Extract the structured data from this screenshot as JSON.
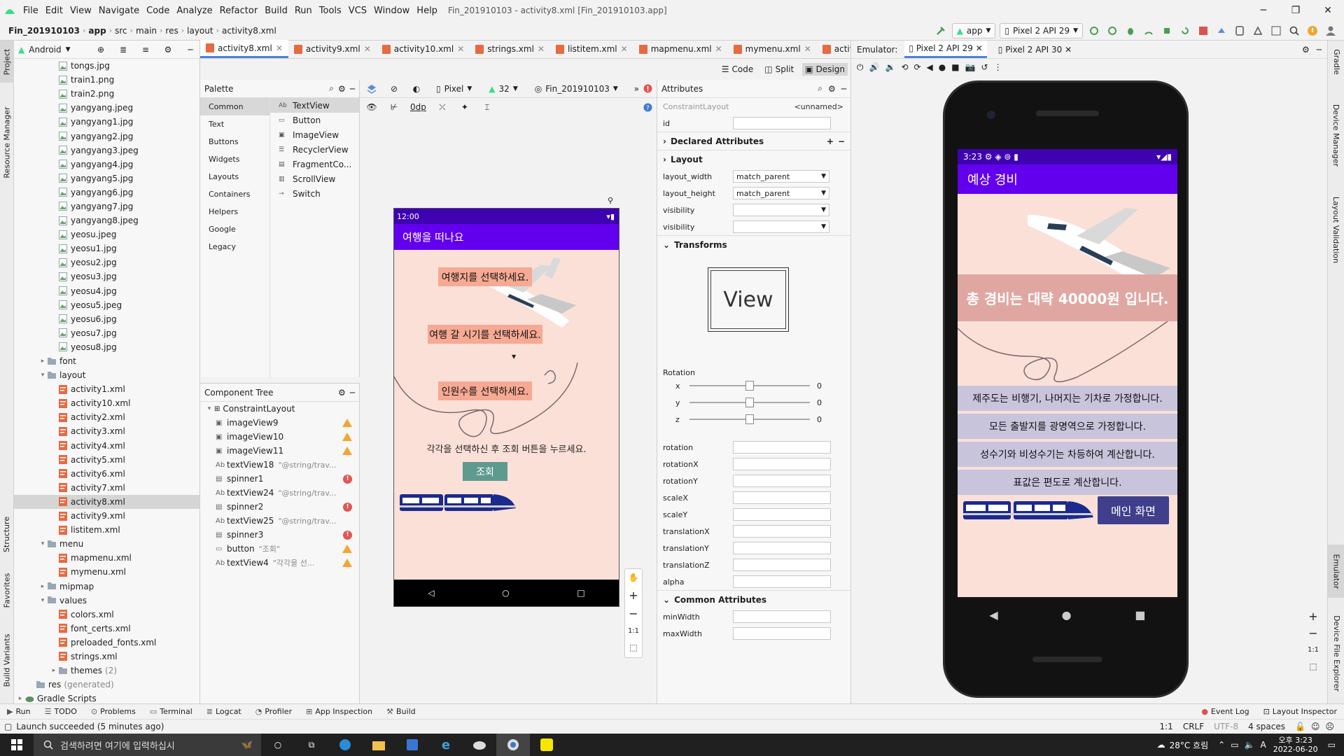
{
  "window": {
    "menu": [
      "File",
      "Edit",
      "View",
      "Navigate",
      "Code",
      "Analyze",
      "Refactor",
      "Build",
      "Run",
      "Tools",
      "VCS",
      "Window",
      "Help"
    ],
    "title": "Fin_201910103 - activity8.xml [Fin_201910103.app]"
  },
  "breadcrumb": [
    "Fin_201910103",
    "app",
    "src",
    "main",
    "res",
    "layout",
    "activity8.xml"
  ],
  "run_config": {
    "module": "app",
    "device": "Pixel 2 API 29"
  },
  "project": {
    "view": "Android",
    "tree": [
      {
        "name": "tongs.jpg",
        "depth": 3,
        "type": "img"
      },
      {
        "name": "train1.png",
        "depth": 3,
        "type": "img"
      },
      {
        "name": "train2.png",
        "depth": 3,
        "type": "img"
      },
      {
        "name": "yangyang.jpeg",
        "depth": 3,
        "type": "img"
      },
      {
        "name": "yangyang1.jpg",
        "depth": 3,
        "type": "img"
      },
      {
        "name": "yangyang2.jpg",
        "depth": 3,
        "type": "img"
      },
      {
        "name": "yangyang3.jpeg",
        "depth": 3,
        "type": "img"
      },
      {
        "name": "yangyang4.jpg",
        "depth": 3,
        "type": "img"
      },
      {
        "name": "yangyang5.jpg",
        "depth": 3,
        "type": "img"
      },
      {
        "name": "yangyang6.jpg",
        "depth": 3,
        "type": "img"
      },
      {
        "name": "yangyang7.jpg",
        "depth": 3,
        "type": "img"
      },
      {
        "name": "yangyang8.jpeg",
        "depth": 3,
        "type": "img"
      },
      {
        "name": "yeosu.jpeg",
        "depth": 3,
        "type": "img"
      },
      {
        "name": "yeosu1.jpg",
        "depth": 3,
        "type": "img"
      },
      {
        "name": "yeosu2.jpg",
        "depth": 3,
        "type": "img"
      },
      {
        "name": "yeosu3.jpg",
        "depth": 3,
        "type": "img"
      },
      {
        "name": "yeosu4.jpg",
        "depth": 3,
        "type": "img"
      },
      {
        "name": "yeosu5.jpeg",
        "depth": 3,
        "type": "img"
      },
      {
        "name": "yeosu6.jpg",
        "depth": 3,
        "type": "img"
      },
      {
        "name": "yeosu7.jpg",
        "depth": 3,
        "type": "img"
      },
      {
        "name": "yeosu8.jpg",
        "depth": 3,
        "type": "img"
      },
      {
        "name": "font",
        "depth": 2,
        "type": "folder",
        "arrow": "▸"
      },
      {
        "name": "layout",
        "depth": 2,
        "type": "folder",
        "arrow": "▾"
      },
      {
        "name": "activity1.xml",
        "depth": 3,
        "type": "xml"
      },
      {
        "name": "activity10.xml",
        "depth": 3,
        "type": "xml"
      },
      {
        "name": "activity2.xml",
        "depth": 3,
        "type": "xml"
      },
      {
        "name": "activity3.xml",
        "depth": 3,
        "type": "xml"
      },
      {
        "name": "activity4.xml",
        "depth": 3,
        "type": "xml"
      },
      {
        "name": "activity5.xml",
        "depth": 3,
        "type": "xml"
      },
      {
        "name": "activity6.xml",
        "depth": 3,
        "type": "xml"
      },
      {
        "name": "activity7.xml",
        "depth": 3,
        "type": "xml"
      },
      {
        "name": "activity8.xml",
        "depth": 3,
        "type": "xml",
        "selected": true
      },
      {
        "name": "activity9.xml",
        "depth": 3,
        "type": "xml"
      },
      {
        "name": "listitem.xml",
        "depth": 3,
        "type": "xml"
      },
      {
        "name": "menu",
        "depth": 2,
        "type": "folder",
        "arrow": "▾"
      },
      {
        "name": "mapmenu.xml",
        "depth": 3,
        "type": "xml"
      },
      {
        "name": "mymenu.xml",
        "depth": 3,
        "type": "xml"
      },
      {
        "name": "mipmap",
        "depth": 2,
        "type": "folder",
        "arrow": "▸"
      },
      {
        "name": "values",
        "depth": 2,
        "type": "folder",
        "arrow": "▾"
      },
      {
        "name": "colors.xml",
        "depth": 3,
        "type": "xml"
      },
      {
        "name": "font_certs.xml",
        "depth": 3,
        "type": "xml"
      },
      {
        "name": "preloaded_fonts.xml",
        "depth": 3,
        "type": "xml"
      },
      {
        "name": "strings.xml",
        "depth": 3,
        "type": "xml"
      },
      {
        "name": "themes",
        "depth": 3,
        "type": "folder",
        "arrow": "▸",
        "suffix": "(2)"
      },
      {
        "name": "res",
        "depth": 1,
        "type": "folder",
        "suffix": "(generated)"
      },
      {
        "name": "Gradle Scripts",
        "depth": 0,
        "type": "gradle",
        "arrow": "▸"
      }
    ]
  },
  "editor_tabs": [
    "activity8.xml",
    "activity9.xml",
    "activity10.xml",
    "strings.xml",
    "listitem.xml",
    "mapmenu.xml",
    "mymenu.xml",
    "activity"
  ],
  "modes": [
    "Code",
    "Split",
    "Design"
  ],
  "palette": {
    "title": "Palette",
    "categories": [
      "Common",
      "Text",
      "Buttons",
      "Widgets",
      "Layouts",
      "Containers",
      "Helpers",
      "Google",
      "Legacy"
    ],
    "items": [
      {
        "icon": "Ab",
        "label": "TextView"
      },
      {
        "icon": "▭",
        "label": "Button"
      },
      {
        "icon": "▣",
        "label": "ImageView"
      },
      {
        "icon": "☰",
        "label": "RecyclerView"
      },
      {
        "icon": "▤",
        "label": "FragmentCo..."
      },
      {
        "icon": "▥",
        "label": "ScrollView"
      },
      {
        "icon": "⊸",
        "label": "Switch"
      }
    ]
  },
  "design_toolbar": {
    "device": "Pixel",
    "api": "32",
    "theme": "Fin_201910103",
    "margin": "0dp"
  },
  "component_tree": {
    "title": "Component Tree",
    "root": "ConstraintLayout",
    "items": [
      {
        "label": "imageView9",
        "icon": "▣",
        "hint": "",
        "status": "warn"
      },
      {
        "label": "imageView10",
        "icon": "▣",
        "hint": "",
        "status": "warn"
      },
      {
        "label": "imageView11",
        "icon": "▣",
        "hint": "",
        "status": "warn"
      },
      {
        "label": "textView18",
        "icon": "Ab",
        "hint": "\"@string/trav...",
        "status": ""
      },
      {
        "label": "spinner1",
        "icon": "▤",
        "hint": "",
        "status": "err"
      },
      {
        "label": "textView24",
        "icon": "Ab",
        "hint": "\"@string/trav...",
        "status": ""
      },
      {
        "label": "spinner2",
        "icon": "▤",
        "hint": "",
        "status": "err"
      },
      {
        "label": "textView25",
        "icon": "Ab",
        "hint": "\"@string/trav...",
        "status": ""
      },
      {
        "label": "spinner3",
        "icon": "▤",
        "hint": "",
        "status": "err"
      },
      {
        "label": "button",
        "icon": "▭",
        "hint": "\"조회\"",
        "status": "warn"
      },
      {
        "label": "textView4",
        "icon": "Ab",
        "hint": "\"각각을 선...",
        "status": "warn"
      }
    ]
  },
  "preview": {
    "time": "12:00",
    "title": "여행을 떠나요",
    "choose_dest": "여행지를 선택하세요.",
    "choose_time": "여행 갈 시기를 선택하세요.",
    "choose_people": "인원수를 선택하세요.",
    "instruction": "각각을 선택하신 후 조회 버튼을 누르세요.",
    "button": "조회",
    "zoom_ratio": "1:1"
  },
  "attributes": {
    "title": "Attributes",
    "class": "ConstraintLayout",
    "id_name": "<unnamed>",
    "id_label": "id",
    "declared": "Declared Attributes",
    "layout": "Layout",
    "layout_rows": [
      {
        "label": "layout_width",
        "value": "match_parent"
      },
      {
        "label": "layout_height",
        "value": "match_parent"
      },
      {
        "label": "visibility",
        "value": ""
      },
      {
        "label": "visibility",
        "value": ""
      }
    ],
    "transforms": "Transforms",
    "view_label": "View",
    "rotation": "Rotation",
    "rotation_axes": [
      {
        "axis": "x",
        "value": "0"
      },
      {
        "axis": "y",
        "value": "0"
      },
      {
        "axis": "z",
        "value": "0"
      }
    ],
    "transform_rows": [
      "rotation",
      "rotationX",
      "rotationY",
      "scaleX",
      "scaleY",
      "translationX",
      "translationY",
      "translationZ",
      "alpha"
    ],
    "common": "Common Attributes",
    "common_rows": [
      "minWidth",
      "maxWidth"
    ]
  },
  "emulator": {
    "label": "Emulator:",
    "tabs": [
      "Pixel 2 API 29",
      "Pixel 2 API 30"
    ],
    "time": "3:23",
    "app_title": "예상 경비",
    "total": "총 경비는 대략 40000원 입니다.",
    "notes": [
      "제주도는 비행기, 나머지는 기차로 가정합니다.",
      "모든 출발지를 광명역으로 가정합니다.",
      "성수기와 비성수기는 차등하여 계산합니다.",
      "표값은 편도로 계산합니다."
    ],
    "main_button": "메인 화면",
    "zoom_ratio": "1:1"
  },
  "bottom_tools": [
    "Run",
    "TODO",
    "Problems",
    "Terminal",
    "Logcat",
    "Profiler",
    "App Inspection",
    "Build"
  ],
  "bottom_right": [
    "Event Log",
    "Layout Inspector"
  ],
  "status": {
    "message": "Launch succeeded (5 minutes ago)",
    "pos": "1:1",
    "eol": "CRLF",
    "enc": "UTF-8",
    "indent": "4 spaces"
  },
  "side_tabs": {
    "left": [
      "Project",
      "Resource Manager",
      "Structure",
      "Favorites",
      "Build Variants"
    ],
    "right": [
      "Gradle",
      "Device Manager",
      "Layout Validation",
      "Emulator",
      "Device File Explorer"
    ]
  },
  "taskbar": {
    "search": "검색하려면 여기에 입력하십시",
    "weather": "28°C 흐림",
    "time": "오후 3:23",
    "date": "2022-06-20",
    "ime": "A"
  },
  "colors": {
    "accent": "#6200ee",
    "statusbar": "#3f02b1",
    "salmon": "#f6a993",
    "canvas_bg": "#fbe0d8",
    "notes_bg": "#c8c4dc",
    "button_teal": "#5f9a8f",
    "main_button": "#3f3f8c"
  }
}
